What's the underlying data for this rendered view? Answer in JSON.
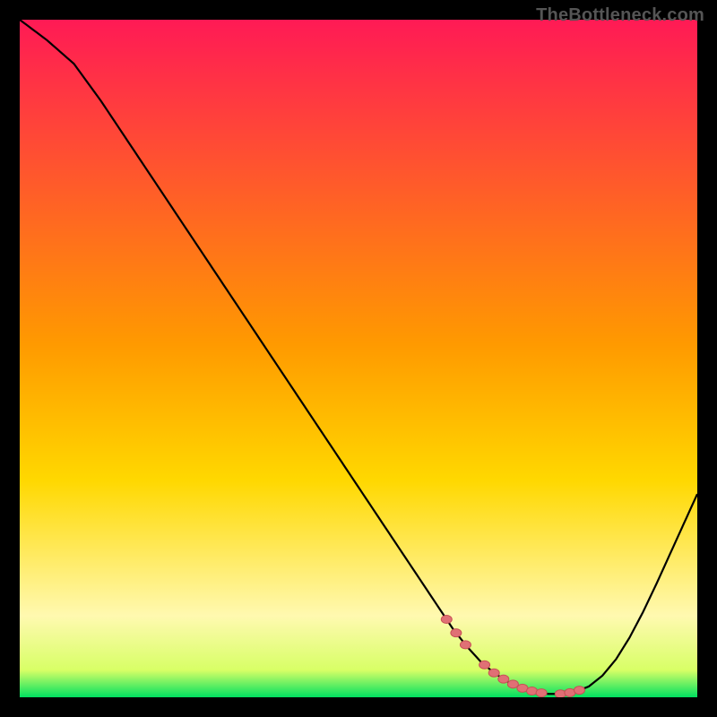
{
  "watermark": "TheBottleneck.com",
  "colors": {
    "bg": "#000000",
    "grad_top": "#ff1a55",
    "grad_mid": "#ffd800",
    "grad_low": "#fff9b0",
    "grad_bottom": "#00e060",
    "curve": "#000000",
    "dot_fill": "#e07075",
    "dot_stroke": "#c75055"
  },
  "chart_data": {
    "type": "line",
    "title": "",
    "xlabel": "",
    "ylabel": "",
    "xlim": [
      0,
      100
    ],
    "ylim": [
      0,
      100
    ],
    "x": [
      0,
      4,
      8,
      12,
      16,
      20,
      24,
      28,
      32,
      36,
      40,
      44,
      48,
      52,
      56,
      60,
      62,
      64,
      66,
      68,
      70,
      72,
      74,
      76,
      78,
      80,
      82,
      84,
      86,
      88,
      90,
      92,
      94,
      96,
      98,
      100
    ],
    "values": [
      100,
      97,
      93.5,
      88,
      82,
      76,
      70,
      64,
      58,
      52,
      46,
      40,
      34,
      28,
      22,
      16,
      13,
      10,
      7.5,
      5.3,
      3.6,
      2.3,
      1.4,
      0.8,
      0.5,
      0.5,
      0.8,
      1.6,
      3.2,
      5.6,
      8.8,
      12.6,
      16.8,
      21.2,
      25.6,
      30
    ],
    "notes": "V-shaped bottleneck curve; y is percent bottleneck, minimum around x≈78-80. Dotted segment along the valley floor between x≈63 and x≈84."
  },
  "dotted_range": {
    "x_start": 63,
    "x_end": 84
  }
}
